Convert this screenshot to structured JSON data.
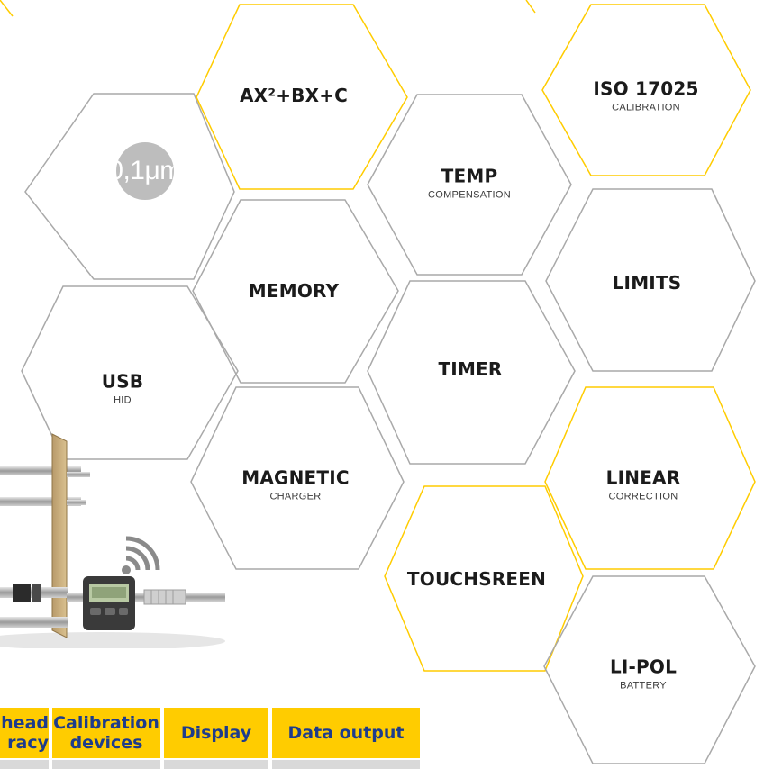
{
  "hexagons": [
    {
      "title": "AX²+BX+C",
      "subtitle": ""
    },
    {
      "title": "ISO 17025",
      "subtitle": "CALIBRATION"
    },
    {
      "title": "TEMP",
      "subtitle": "COMPENSATION"
    },
    {
      "title": "MEMORY",
      "subtitle": ""
    },
    {
      "title": "LIMITS",
      "subtitle": ""
    },
    {
      "title": "USB",
      "subtitle": "HID"
    },
    {
      "title": "TIMER",
      "subtitle": ""
    },
    {
      "title": "MAGNETIC",
      "subtitle": "CHARGER"
    },
    {
      "title": "LINEAR",
      "subtitle": "CORRECTION"
    },
    {
      "title": "TOUCHSREEN",
      "subtitle": ""
    },
    {
      "title": "LI-POL",
      "subtitle": "BATTERY"
    }
  ],
  "badge": {
    "text": "0,1μm"
  },
  "table": {
    "headers": [
      "head\nracy",
      "Calibration devices",
      "Display",
      "Data output"
    ]
  },
  "colors": {
    "yellow": "#ffcc00",
    "gray_outline": "#a9a9a9",
    "navy": "#1e3c8c"
  },
  "icons": {
    "wireless": "wifi-signal-icon"
  }
}
